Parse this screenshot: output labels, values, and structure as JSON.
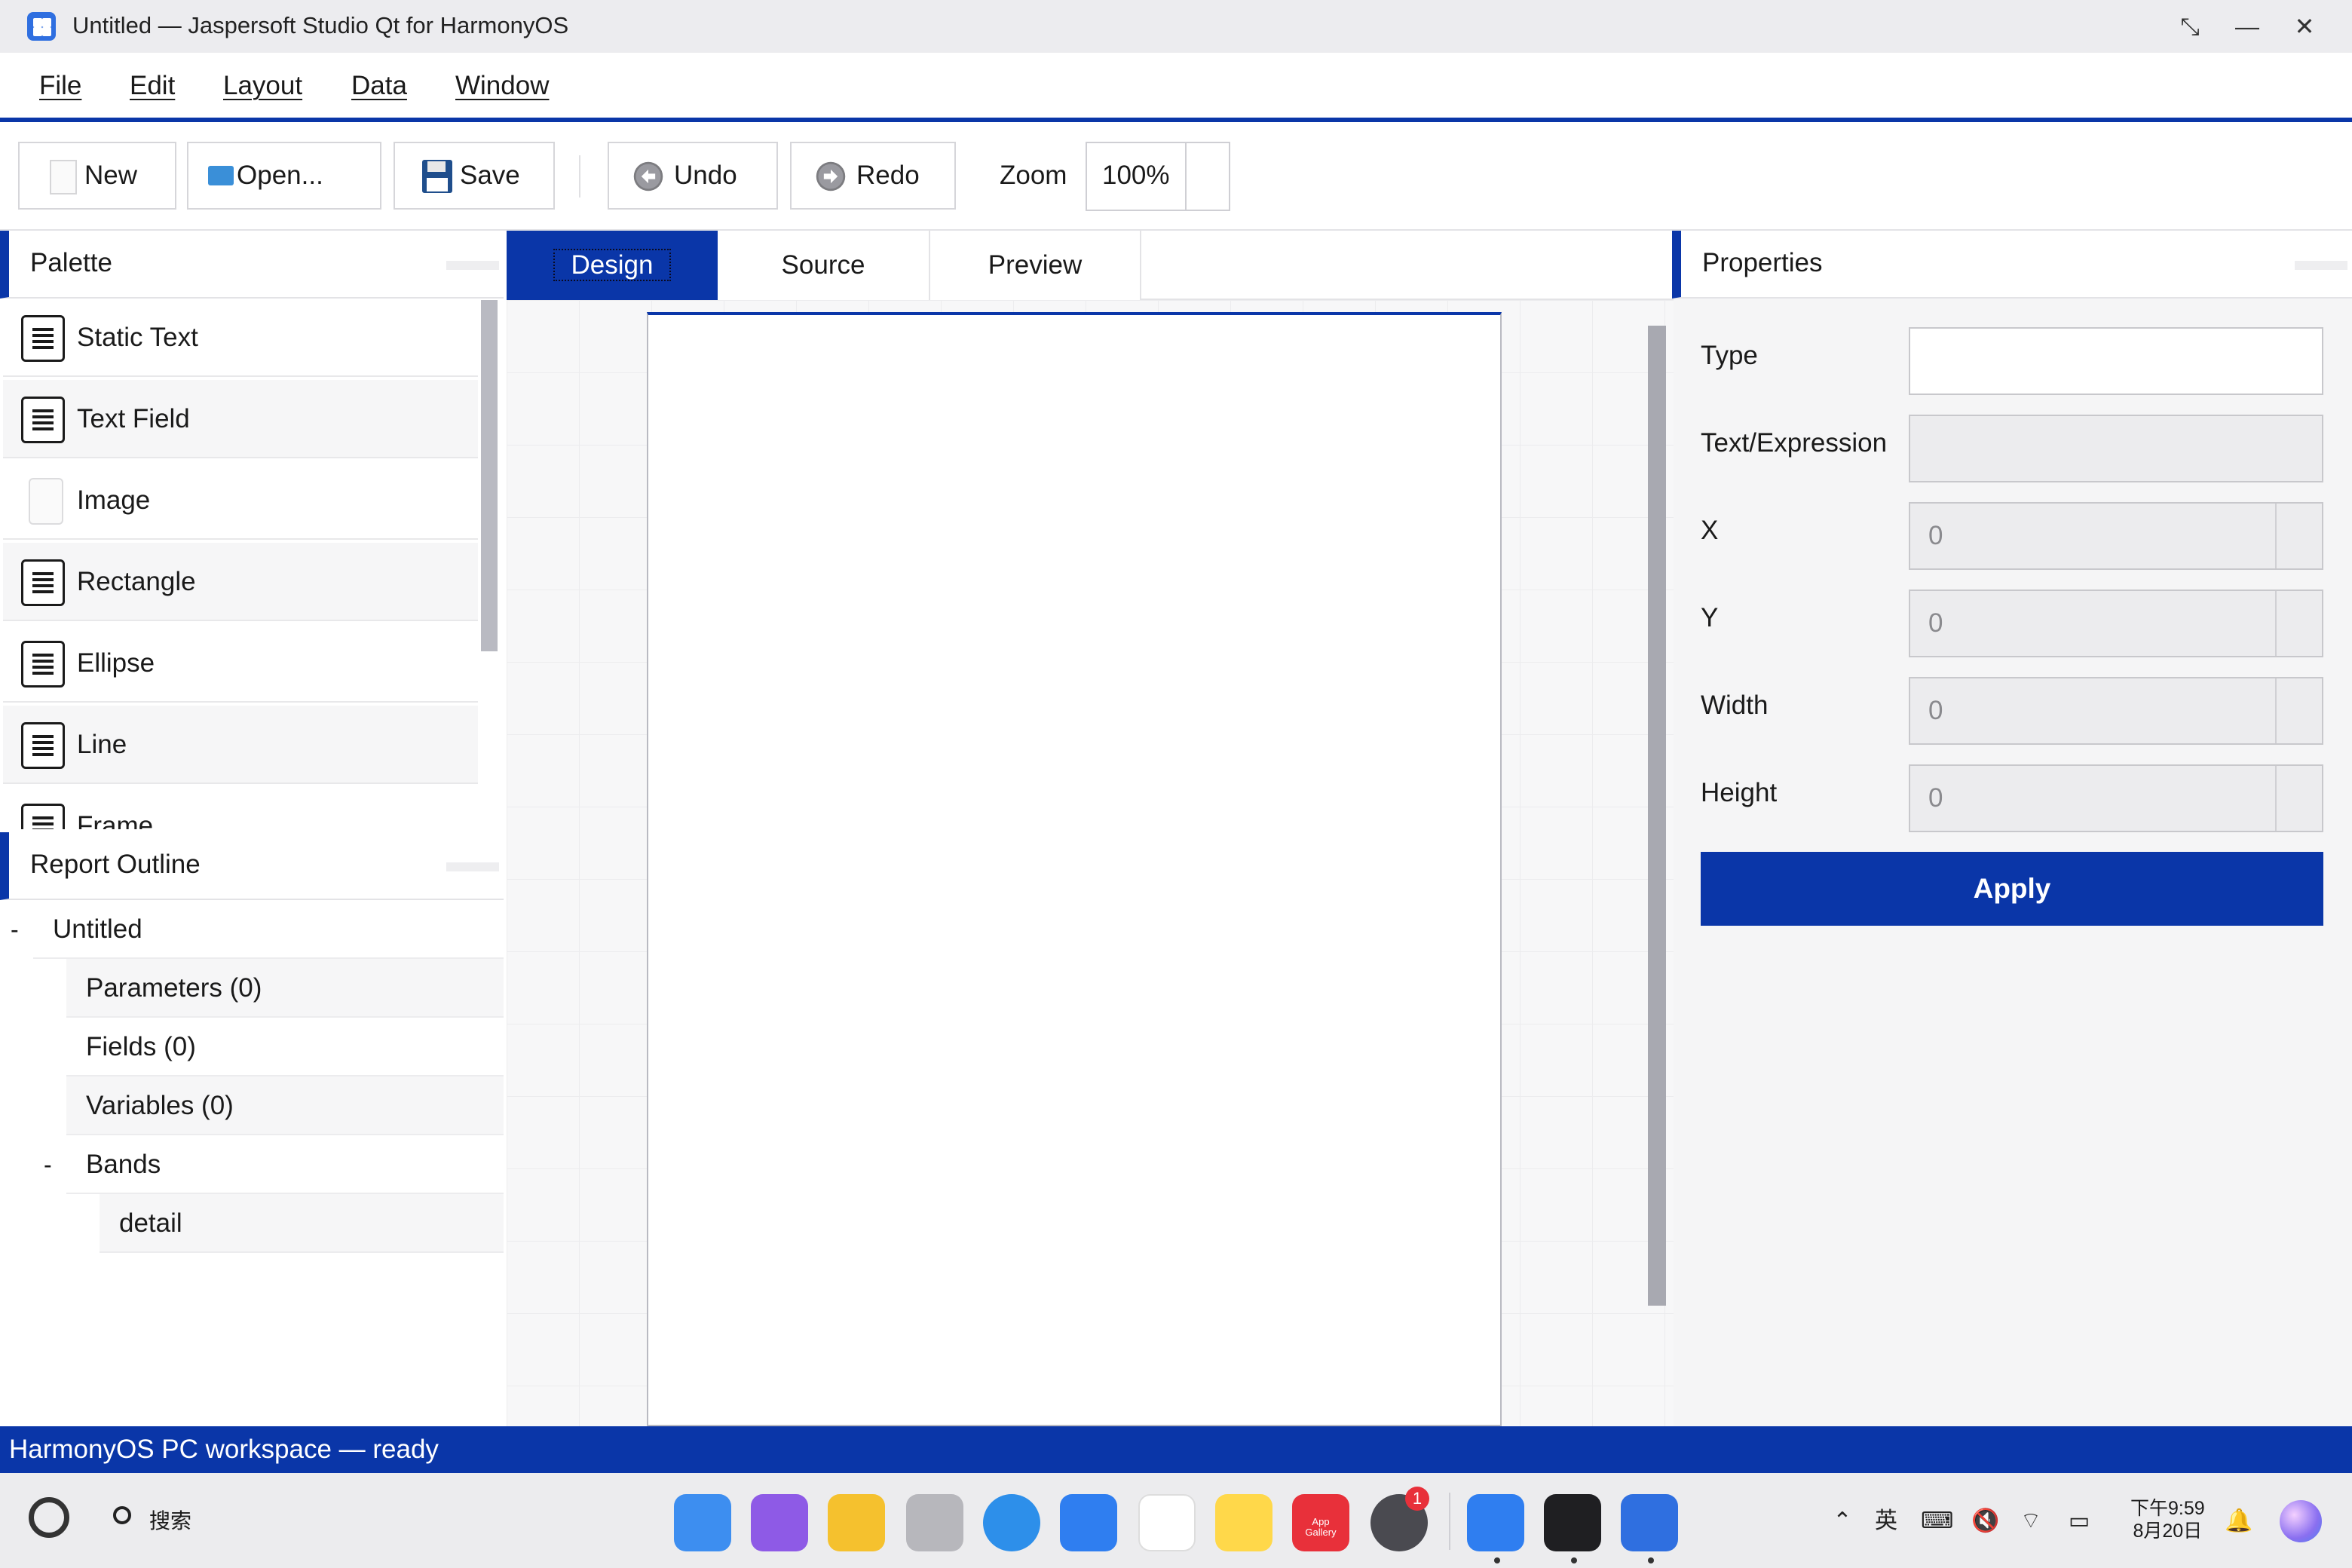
{
  "window": {
    "title": "Untitled — Jaspersoft Studio Qt for HarmonyOS",
    "controls": {
      "restore": "⤡",
      "minimize": "—",
      "close": "✕"
    }
  },
  "menu": [
    "File",
    "Edit",
    "Layout",
    "Data",
    "Window"
  ],
  "toolbar": {
    "new": "New",
    "open": "Open...",
    "save": "Save",
    "undo": "Undo",
    "redo": "Redo",
    "zoom_label": "Zoom",
    "zoom_value": "100%"
  },
  "palette": {
    "title": "Palette",
    "items": [
      "Static Text",
      "Text Field",
      "Image",
      "Rectangle",
      "Ellipse",
      "Line",
      "Frame"
    ]
  },
  "outline": {
    "title": "Report Outline",
    "root_toggle": "-",
    "root": "Untitled",
    "parameters": "Parameters (0)",
    "fields": "Fields (0)",
    "variables": "Variables (0)",
    "bands_toggle": "-",
    "bands": "Bands",
    "detail": "detail"
  },
  "tabs": [
    "Design",
    "Source",
    "Preview"
  ],
  "properties": {
    "title": "Properties",
    "type_label": "Type",
    "type_value": "",
    "text_label": "Text/Expression",
    "text_value": "",
    "x_label": "X",
    "x_value": "0",
    "y_label": "Y",
    "y_value": "0",
    "width_label": "Width",
    "width_value": "0",
    "height_label": "Height",
    "height_value": "0",
    "apply": "Apply"
  },
  "status": "HarmonyOS PC workspace — ready",
  "taskbar": {
    "search": "搜索",
    "app_gallery_line1": "App",
    "app_gallery_line2": "Gallery",
    "settings_badge": "1",
    "ime": "英",
    "time": "下午9:59",
    "date": "8月20日"
  },
  "colors": {
    "accent": "#0a36a8",
    "titlebar": "#ececef",
    "panel": "#f5f5f6"
  }
}
